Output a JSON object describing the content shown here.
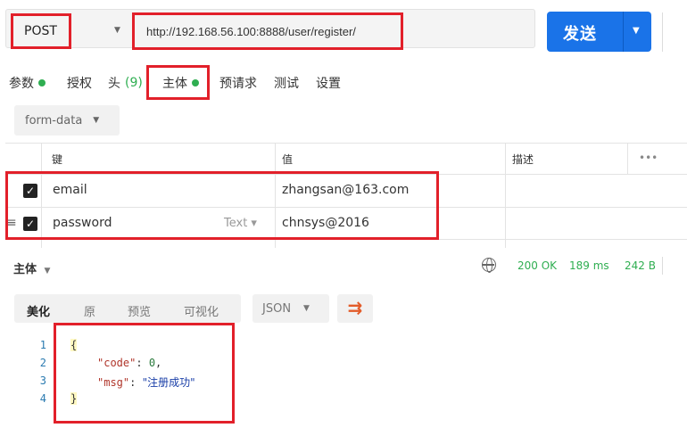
{
  "request": {
    "method": "POST",
    "url": "http://192.168.56.100:8888/user/register/",
    "send_label": "发送"
  },
  "tabs": [
    {
      "label": "参数",
      "dot": true
    },
    {
      "label": "授权"
    },
    {
      "label": "头",
      "count": "(9)"
    },
    {
      "label": "主体",
      "dot": true,
      "active": true
    },
    {
      "label": "预请求"
    },
    {
      "label": "测试"
    },
    {
      "label": "设置"
    }
  ],
  "body_mode": "form-data",
  "params_table": {
    "headers": {
      "key": "键",
      "value": "值",
      "description": "描述",
      "more": "•••"
    },
    "rows": [
      {
        "checked": true,
        "key": "email",
        "value": "zhangsan@163.com"
      },
      {
        "checked": true,
        "key": "password",
        "type": "Text ▾",
        "value": "chnsys@2016"
      }
    ]
  },
  "response": {
    "label": "主体",
    "status": "200 OK",
    "time": "189 ms",
    "size": "242 B",
    "view_tabs": [
      "美化",
      "原",
      "预览",
      "可视化"
    ],
    "format": "JSON",
    "code_lines": [
      "{",
      "\"code\": 0,",
      "\"msg\": \"注册成功\"",
      "}"
    ],
    "json": {
      "code_key": "\"code\"",
      "code_val": "0",
      "msg_key": "\"msg\"",
      "msg_val": "\"注册成功\""
    },
    "line_numbers": [
      "1",
      "2",
      "3",
      "4"
    ]
  },
  "colors": {
    "accent": "#1a73e8",
    "highlight": "#e2202a",
    "success": "#2fae51"
  }
}
